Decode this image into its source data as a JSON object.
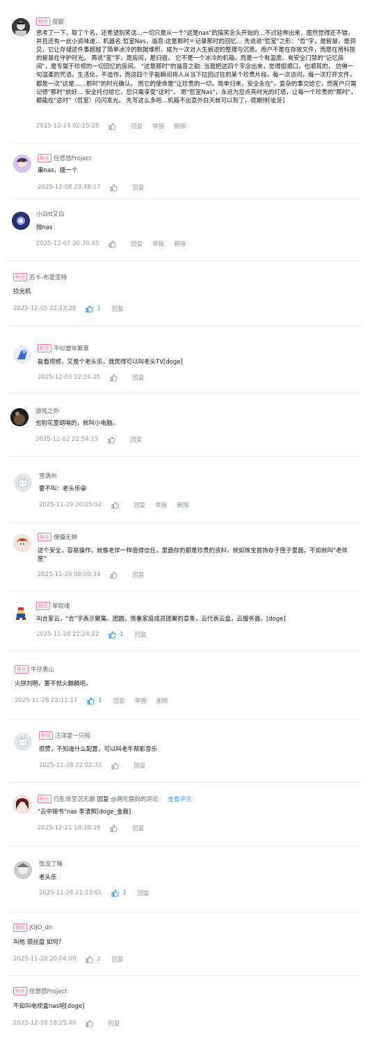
{
  "badge_label": "粉丝",
  "actions": {
    "reply": "回复",
    "report": "举报",
    "delete": "删除"
  },
  "comments": [
    {
      "username": "俊毅",
      "content": "思考了一下，取了个名，还希望别笑话…一切只是从一个\"这是nas\"的搞笑念头开始的…不过延伸出来，居然觉得还不错，并且还有一丝小资味道… 机器名:哲室Nas，谐音:这是那时＝记录那时的回忆… 先说说\"哲室\"之形：\"哲\"字，是智慧，是洞见，它让存储这件事超越了简单冰冷的数据堆积，成为一次对人生痕迹的整理与沉思。用户不是在存放文件，而是在用科技的智慧在守护时光。 再说\"室\"字，是房间，是归宿。 它不是一个冰冷的机箱，而是一个有温度、有安全门禁的\"记忆房间\"，是专属于珍视的一切回忆的房间。 \"这是那时\"的谐音之韵: 当我把这四个字念出来，觉得挺顺口，也顺耳的， 仿佛一句温柔的咒语。生活化，不造作，而这四个字能瞬间将人从当下拉回过往的某个珍贵片段。每一次访问，每一次打开文件，都是一次\"这是……那时\"的时光确认。 而它的使命是\"让珍贵的一切，简单归来，安全永在\"。复杂的事交给它，而客户只需记得\"那时\"就好… 安全托付给它，您只需享受\"这时\"。 愿\"哲室Nas\"，永远为您点亮时光的灯塔，让每一个珍贵的\"那时\"，都能在\"这时\"（哲室）闪闪发光。 先写这么多吧…机箱不出意外白天就可以到了，很期待[呲牙]",
      "time": "2025-12-14 02:15:28",
      "likes": "",
      "report": true,
      "delete": true
    },
    {
      "username": "任悠悠Project",
      "content": "康nas，援一个",
      "time": "2025-12-08 23:48:17",
      "likes": ""
    },
    {
      "username": "小白tt又白",
      "content": "微nas",
      "time": "2025-12-07 20:30:45",
      "likes": "",
      "report": true,
      "delete": true
    },
    {
      "username": "苏卡-布里亚特",
      "content": "捡光机",
      "time": "2025-12-05 22:23:28",
      "likes": "1"
    },
    {
      "username": "不似當年繁華",
      "content": "能看视频，又是个老头乐，我觉得可以叫老头TV[doge]",
      "time": "2025-12-03 22:24:25",
      "likes": ""
    },
    {
      "username": "游戏之外",
      "content": "也别花里胡哨的，就叫小电脑。",
      "time": "2025-12-02 22:54:15",
      "likes": ""
    },
    {
      "username": "雪满州",
      "content": "要不叫：老头乐😁",
      "time": "2025-11-29 20:05:52",
      "likes": "",
      "report": true,
      "delete": true
    },
    {
      "username": "傀儡无神",
      "content": "这个安全，容易操作，就像老伴一样值得信任，里面存的都是珍贵的资料，就如珠宝首饰存于匣子里面，不如就叫\"老伴匣\"",
      "time": "2025-11-29 08:00:34",
      "likes": ""
    },
    {
      "username": "萃取魂",
      "content": "叫合家云，\"合\"字表示聚集、团圆，侧重家庭成员团聚的意象，云代表云盘，云服务器。[doge]",
      "time": "2025-11-28 22:24:22",
      "likes": "1"
    },
    {
      "username": "牛仔香山",
      "content": "火拼刘明。要不就火麒麟吧。",
      "time": "2025-11-28 22:11:17",
      "likes": "1",
      "report": true,
      "delete": true
    },
    {
      "username": "汪洋里一只船",
      "content": "很赞，不知道什么配置，可以叫老牛帮影音乐",
      "time": "2025-11-28 22:02:33",
      "likes": ""
    },
    {
      "username": "行乱世至沉无期",
      "reply_word": "回复",
      "reply_target": "@两坨猿妈的评论",
      "reply_link": "查看评论",
      "content": "\"云中锦书\"nas 李清照[doge_金箍]",
      "time": "2025-12-21 14:38:19",
      "likes": ""
    },
    {
      "username": "饭没了睡",
      "content": "老头乐",
      "time": "2025-11-28 21:33:01",
      "likes": "1"
    },
    {
      "username": "JOJO_dn",
      "content": "叫他 银丝盘 如何?",
      "time": "2025-11-28 20:04:00",
      "likes": "2"
    },
    {
      "username": "任悠悠Project",
      "content": "不如叫电视盒nas吧[doge]",
      "time": "2025-12-18 18:25:40",
      "likes": ""
    }
  ]
}
